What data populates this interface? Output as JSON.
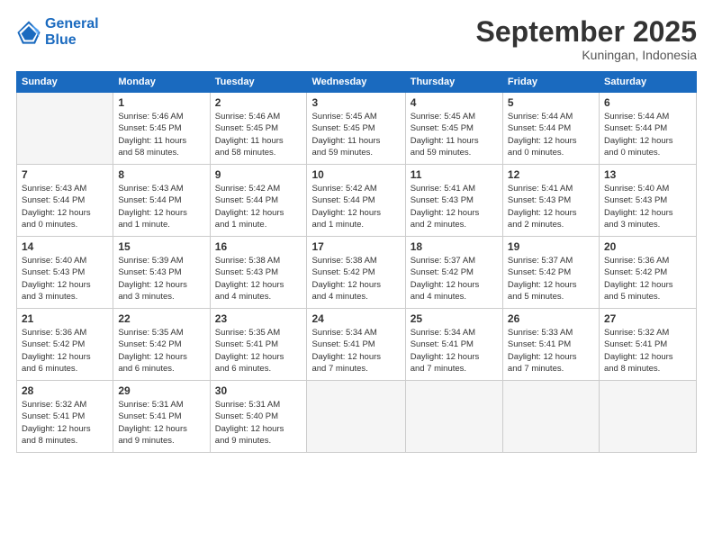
{
  "logo": {
    "line1": "General",
    "line2": "Blue"
  },
  "title": "September 2025",
  "location": "Kuningan, Indonesia",
  "days_header": [
    "Sunday",
    "Monday",
    "Tuesday",
    "Wednesday",
    "Thursday",
    "Friday",
    "Saturday"
  ],
  "weeks": [
    [
      {
        "day": "",
        "info": ""
      },
      {
        "day": "1",
        "info": "Sunrise: 5:46 AM\nSunset: 5:45 PM\nDaylight: 11 hours\nand 58 minutes."
      },
      {
        "day": "2",
        "info": "Sunrise: 5:46 AM\nSunset: 5:45 PM\nDaylight: 11 hours\nand 58 minutes."
      },
      {
        "day": "3",
        "info": "Sunrise: 5:45 AM\nSunset: 5:45 PM\nDaylight: 11 hours\nand 59 minutes."
      },
      {
        "day": "4",
        "info": "Sunrise: 5:45 AM\nSunset: 5:45 PM\nDaylight: 11 hours\nand 59 minutes."
      },
      {
        "day": "5",
        "info": "Sunrise: 5:44 AM\nSunset: 5:44 PM\nDaylight: 12 hours\nand 0 minutes."
      },
      {
        "day": "6",
        "info": "Sunrise: 5:44 AM\nSunset: 5:44 PM\nDaylight: 12 hours\nand 0 minutes."
      }
    ],
    [
      {
        "day": "7",
        "info": "Sunrise: 5:43 AM\nSunset: 5:44 PM\nDaylight: 12 hours\nand 0 minutes."
      },
      {
        "day": "8",
        "info": "Sunrise: 5:43 AM\nSunset: 5:44 PM\nDaylight: 12 hours\nand 1 minute."
      },
      {
        "day": "9",
        "info": "Sunrise: 5:42 AM\nSunset: 5:44 PM\nDaylight: 12 hours\nand 1 minute."
      },
      {
        "day": "10",
        "info": "Sunrise: 5:42 AM\nSunset: 5:44 PM\nDaylight: 12 hours\nand 1 minute."
      },
      {
        "day": "11",
        "info": "Sunrise: 5:41 AM\nSunset: 5:43 PM\nDaylight: 12 hours\nand 2 minutes."
      },
      {
        "day": "12",
        "info": "Sunrise: 5:41 AM\nSunset: 5:43 PM\nDaylight: 12 hours\nand 2 minutes."
      },
      {
        "day": "13",
        "info": "Sunrise: 5:40 AM\nSunset: 5:43 PM\nDaylight: 12 hours\nand 3 minutes."
      }
    ],
    [
      {
        "day": "14",
        "info": "Sunrise: 5:40 AM\nSunset: 5:43 PM\nDaylight: 12 hours\nand 3 minutes."
      },
      {
        "day": "15",
        "info": "Sunrise: 5:39 AM\nSunset: 5:43 PM\nDaylight: 12 hours\nand 3 minutes."
      },
      {
        "day": "16",
        "info": "Sunrise: 5:38 AM\nSunset: 5:43 PM\nDaylight: 12 hours\nand 4 minutes."
      },
      {
        "day": "17",
        "info": "Sunrise: 5:38 AM\nSunset: 5:42 PM\nDaylight: 12 hours\nand 4 minutes."
      },
      {
        "day": "18",
        "info": "Sunrise: 5:37 AM\nSunset: 5:42 PM\nDaylight: 12 hours\nand 4 minutes."
      },
      {
        "day": "19",
        "info": "Sunrise: 5:37 AM\nSunset: 5:42 PM\nDaylight: 12 hours\nand 5 minutes."
      },
      {
        "day": "20",
        "info": "Sunrise: 5:36 AM\nSunset: 5:42 PM\nDaylight: 12 hours\nand 5 minutes."
      }
    ],
    [
      {
        "day": "21",
        "info": "Sunrise: 5:36 AM\nSunset: 5:42 PM\nDaylight: 12 hours\nand 6 minutes."
      },
      {
        "day": "22",
        "info": "Sunrise: 5:35 AM\nSunset: 5:42 PM\nDaylight: 12 hours\nand 6 minutes."
      },
      {
        "day": "23",
        "info": "Sunrise: 5:35 AM\nSunset: 5:41 PM\nDaylight: 12 hours\nand 6 minutes."
      },
      {
        "day": "24",
        "info": "Sunrise: 5:34 AM\nSunset: 5:41 PM\nDaylight: 12 hours\nand 7 minutes."
      },
      {
        "day": "25",
        "info": "Sunrise: 5:34 AM\nSunset: 5:41 PM\nDaylight: 12 hours\nand 7 minutes."
      },
      {
        "day": "26",
        "info": "Sunrise: 5:33 AM\nSunset: 5:41 PM\nDaylight: 12 hours\nand 7 minutes."
      },
      {
        "day": "27",
        "info": "Sunrise: 5:32 AM\nSunset: 5:41 PM\nDaylight: 12 hours\nand 8 minutes."
      }
    ],
    [
      {
        "day": "28",
        "info": "Sunrise: 5:32 AM\nSunset: 5:41 PM\nDaylight: 12 hours\nand 8 minutes."
      },
      {
        "day": "29",
        "info": "Sunrise: 5:31 AM\nSunset: 5:41 PM\nDaylight: 12 hours\nand 9 minutes."
      },
      {
        "day": "30",
        "info": "Sunrise: 5:31 AM\nSunset: 5:40 PM\nDaylight: 12 hours\nand 9 minutes."
      },
      {
        "day": "",
        "info": ""
      },
      {
        "day": "",
        "info": ""
      },
      {
        "day": "",
        "info": ""
      },
      {
        "day": "",
        "info": ""
      }
    ]
  ]
}
